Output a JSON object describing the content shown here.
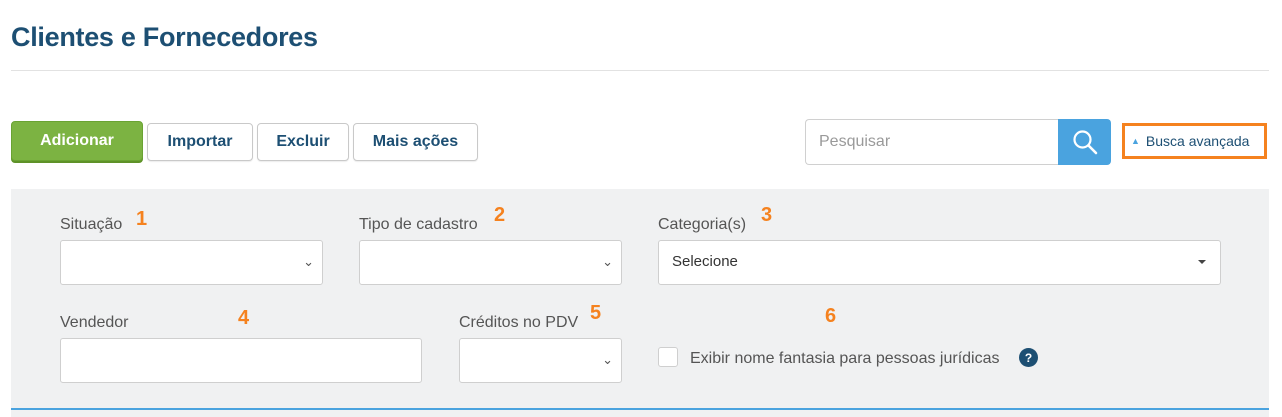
{
  "header": {
    "title": "Clientes e Fornecedores"
  },
  "toolbar": {
    "add_label": "Adicionar",
    "import_label": "Importar",
    "delete_label": "Excluir",
    "more_label": "Mais ações"
  },
  "search": {
    "placeholder": "Pesquisar",
    "advanced_label": "Busca avançada"
  },
  "filters": {
    "situacao": {
      "label": "Situação",
      "marker": "1",
      "value": ""
    },
    "tipo": {
      "label": "Tipo de cadastro",
      "marker": "2",
      "value": ""
    },
    "categoria": {
      "label": "Categoria(s)",
      "marker": "3",
      "value": "Selecione"
    },
    "vendedor": {
      "label": "Vendedor",
      "marker": "4",
      "value": ""
    },
    "creditos": {
      "label": "Créditos no PDV",
      "marker": "5",
      "value": ""
    },
    "fantasia": {
      "marker": "6",
      "label": "Exibir nome fantasia para pessoas jurídicas",
      "checked": false,
      "help": "?"
    }
  },
  "colors": {
    "primary": "#1d4f73",
    "add_button": "#7cb342",
    "search_button": "#4aa3df",
    "highlight": "#f5821f",
    "panel": "#f0f1f2"
  },
  "icons": {
    "search": "search-icon",
    "chevron": "chevron-down-icon",
    "caret": "caret-up-icon",
    "help": "help-icon"
  }
}
